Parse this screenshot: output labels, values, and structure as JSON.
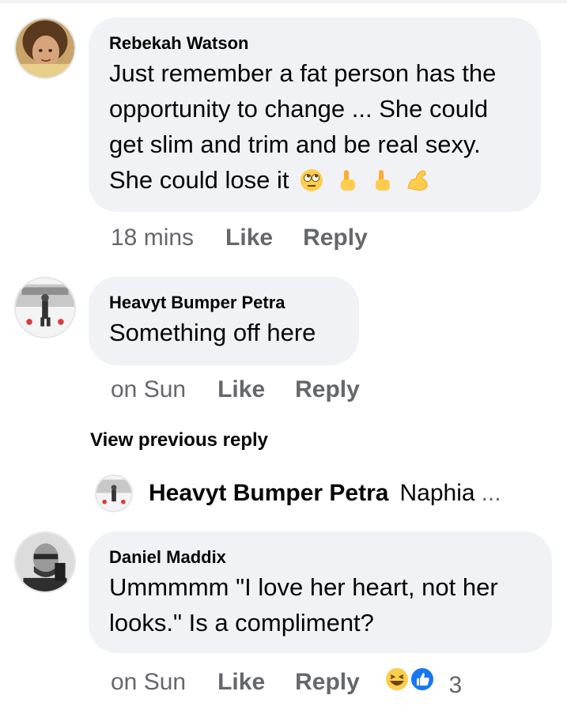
{
  "comments": [
    {
      "author": "Rebekah Watson",
      "text": "Just remember a fat person has the opportunity to change ... She could get slim and trim and be real sexy. She could lose it",
      "emojis": [
        "face-with-rolling-eyes-icon",
        "pointing-hand-icon",
        "pointing-hand-icon",
        "flexed-biceps-icon"
      ],
      "time": "18 mins",
      "like_label": "Like",
      "reply_label": "Reply"
    },
    {
      "author": "Heavyt Bumper Petra",
      "text": "Something off here",
      "time": "on Sun",
      "like_label": "Like",
      "reply_label": "Reply"
    },
    {
      "author": "Daniel Maddix",
      "text": "Ummmmm \"I love her heart, not her looks.\" Is a compliment?",
      "time": "on Sun",
      "like_label": "Like",
      "reply_label": "Reply",
      "reactions": [
        "laughing-face-icon",
        "thumbs-up-icon"
      ],
      "reaction_count": "3"
    }
  ],
  "view_previous_reply": "View previous reply",
  "collapsed_reply": {
    "author": "Heavyt Bumper Petra",
    "preview": "Naphia",
    "ellipsis": "..."
  },
  "colors": {
    "bubble": "#f0f2f5",
    "meta_text": "#65676b",
    "text": "#050505",
    "like_blue": "#1877f2"
  }
}
